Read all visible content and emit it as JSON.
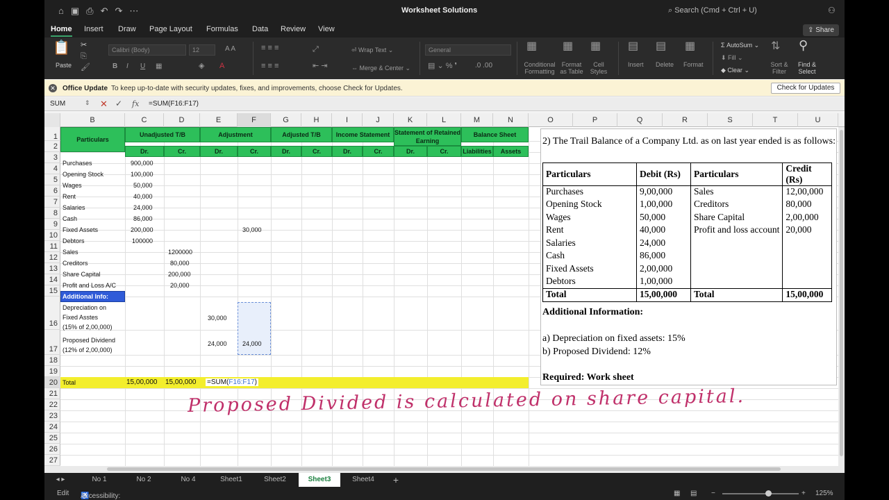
{
  "window": {
    "title": "Worksheet Solutions",
    "search_placeholder": "Search (Cmd + Ctrl + U)"
  },
  "ribbon_tabs": [
    "Home",
    "Insert",
    "Draw",
    "Page Layout",
    "Formulas",
    "Data",
    "Review",
    "View"
  ],
  "share_label": "Share",
  "ribbon": {
    "paste": "Paste",
    "font_name": "Calibri (Body)",
    "font_size": "12",
    "wrap_text": "Wrap Text",
    "merge_center": "Merge & Center",
    "number_format": "General",
    "conditional": "Conditional Formatting",
    "format_table": "Format as Table",
    "cell_styles": "Cell Styles",
    "insert": "Insert",
    "delete": "Delete",
    "format": "Format",
    "autosum": "AutoSum",
    "fill": "Fill",
    "clear": "Clear",
    "sort_filter": "Sort & Filter",
    "find_select": "Find & Select"
  },
  "update_bar": {
    "title": "Office Update",
    "message": "To keep up-to-date with security updates, fixes, and improvements, choose Check for Updates.",
    "button": "Check for Updates"
  },
  "formula_bar": {
    "name_box": "SUM",
    "fx": "fx",
    "formula": "=SUM(F16:F17)"
  },
  "columns": [
    "B",
    "C",
    "D",
    "E",
    "F",
    "G",
    "H",
    "I",
    "J",
    "K",
    "L",
    "M",
    "N",
    "O",
    "P",
    "Q",
    "R",
    "S",
    "T",
    "U"
  ],
  "rows": [
    "1",
    "2",
    "3",
    "4",
    "5",
    "6",
    "7",
    "8",
    "9",
    "10",
    "11",
    "12",
    "13",
    "14",
    "15",
    "16",
    "17",
    "18",
    "19",
    "20",
    "21",
    "22",
    "23",
    "24",
    "25",
    "26",
    "27"
  ],
  "sheet_headers": {
    "particulars": "Particulars",
    "unadjusted": "Unadjusted T/B",
    "adjustment": "Adjustment",
    "adjusted": "Adjusted T/B",
    "income": "Income Statement",
    "retained": "Statement of Retained Earning",
    "balance": "Balance Sheet",
    "sub": [
      "Dr.",
      "Cr.",
      "Dr.",
      "Cr.",
      "Dr.",
      "Cr.",
      "Dr.",
      "Cr.",
      "Dr.",
      "Cr.",
      "Liabilities",
      "Assets"
    ]
  },
  "sheet_rows": [
    {
      "label": "Purchases",
      "c": "900,000",
      "d": ""
    },
    {
      "label": "Opening Stock",
      "c": "100,000",
      "d": ""
    },
    {
      "label": "Wages",
      "c": "50,000",
      "d": ""
    },
    {
      "label": "Rent",
      "c": "40,000",
      "d": ""
    },
    {
      "label": "Salaries",
      "c": "24,000",
      "d": ""
    },
    {
      "label": "Cash",
      "c": "86,000",
      "d": ""
    },
    {
      "label": "Fixed Assets",
      "c": "200,000",
      "d": "",
      "f": "30,000"
    },
    {
      "label": "Debtors",
      "c": "100000",
      "d": ""
    },
    {
      "label": "Sales",
      "c": "",
      "d": "1200000"
    },
    {
      "label": "Creditors",
      "c": "",
      "d": "80,000"
    },
    {
      "label": "Share Capital",
      "c": "",
      "d": "200,000"
    },
    {
      "label": "Profit and Loss A/C",
      "c": "",
      "d": "20,000"
    }
  ],
  "additional_info": "Additional Info:",
  "row16": {
    "line1": "Depreciation on",
    "line2": "Fixed Asstes",
    "line3": "(15% of 2,00,000)",
    "e": "30,000"
  },
  "row17": {
    "line1": "Proposed Dividend",
    "line2": "(12% of 2,00,000)",
    "e": "24,000",
    "f": "24,000"
  },
  "total_row": {
    "label": "Total",
    "c": "15,00,000",
    "d": "15,00,000",
    "formula_prefix": "=SUM(",
    "formula_ref": "F16:F17",
    "formula_suffix": ")"
  },
  "image_question": {
    "title": "2)  The Trail Balance of a Company Ltd. as on last year ended is as follows:",
    "headers": [
      "Particulars",
      "Debit (Rs)",
      "Particulars",
      "Credit (Rs)"
    ],
    "rows": [
      [
        "Purchases",
        "9,00,000",
        "Sales",
        "12,00,000"
      ],
      [
        "Opening Stock",
        "1,00,000",
        "Creditors",
        "80,000"
      ],
      [
        "Wages",
        "50,000",
        "Share Capital",
        "2,00,000"
      ],
      [
        "Rent",
        "40,000",
        "Profit and loss account",
        "20,000"
      ],
      [
        "Salaries",
        "24,000",
        "",
        ""
      ],
      [
        "Cash",
        "86,000",
        "",
        ""
      ],
      [
        "Fixed Assets",
        "2,00,000",
        "",
        ""
      ],
      [
        "Debtors",
        "1,00,000",
        "",
        ""
      ]
    ],
    "total": [
      "Total",
      "15,00,000",
      "Total",
      "15,00,000"
    ],
    "additional": "Additional Information:",
    "item_a": "a)  Depreciation on fixed assets: 15%",
    "item_b": "b)  Proposed Dividend: 12%",
    "required": "Required: Work sheet"
  },
  "handwritten_note": "Proposed Divided is calculated on share capital.",
  "sheet_tabs": [
    "No 1",
    "No 2",
    "No 4",
    "Sheet1",
    "Sheet2",
    "Sheet3",
    "Sheet4"
  ],
  "active_sheet": "Sheet3",
  "status": {
    "mode": "Edit",
    "accessibility": "Accessibility: Investigate",
    "zoom": "125%"
  },
  "colors": {
    "header_green": "#2dbf5a",
    "total_yellow": "#f3ee2d",
    "additional_blue": "#2f5bd8",
    "ink": "#c0306a"
  }
}
